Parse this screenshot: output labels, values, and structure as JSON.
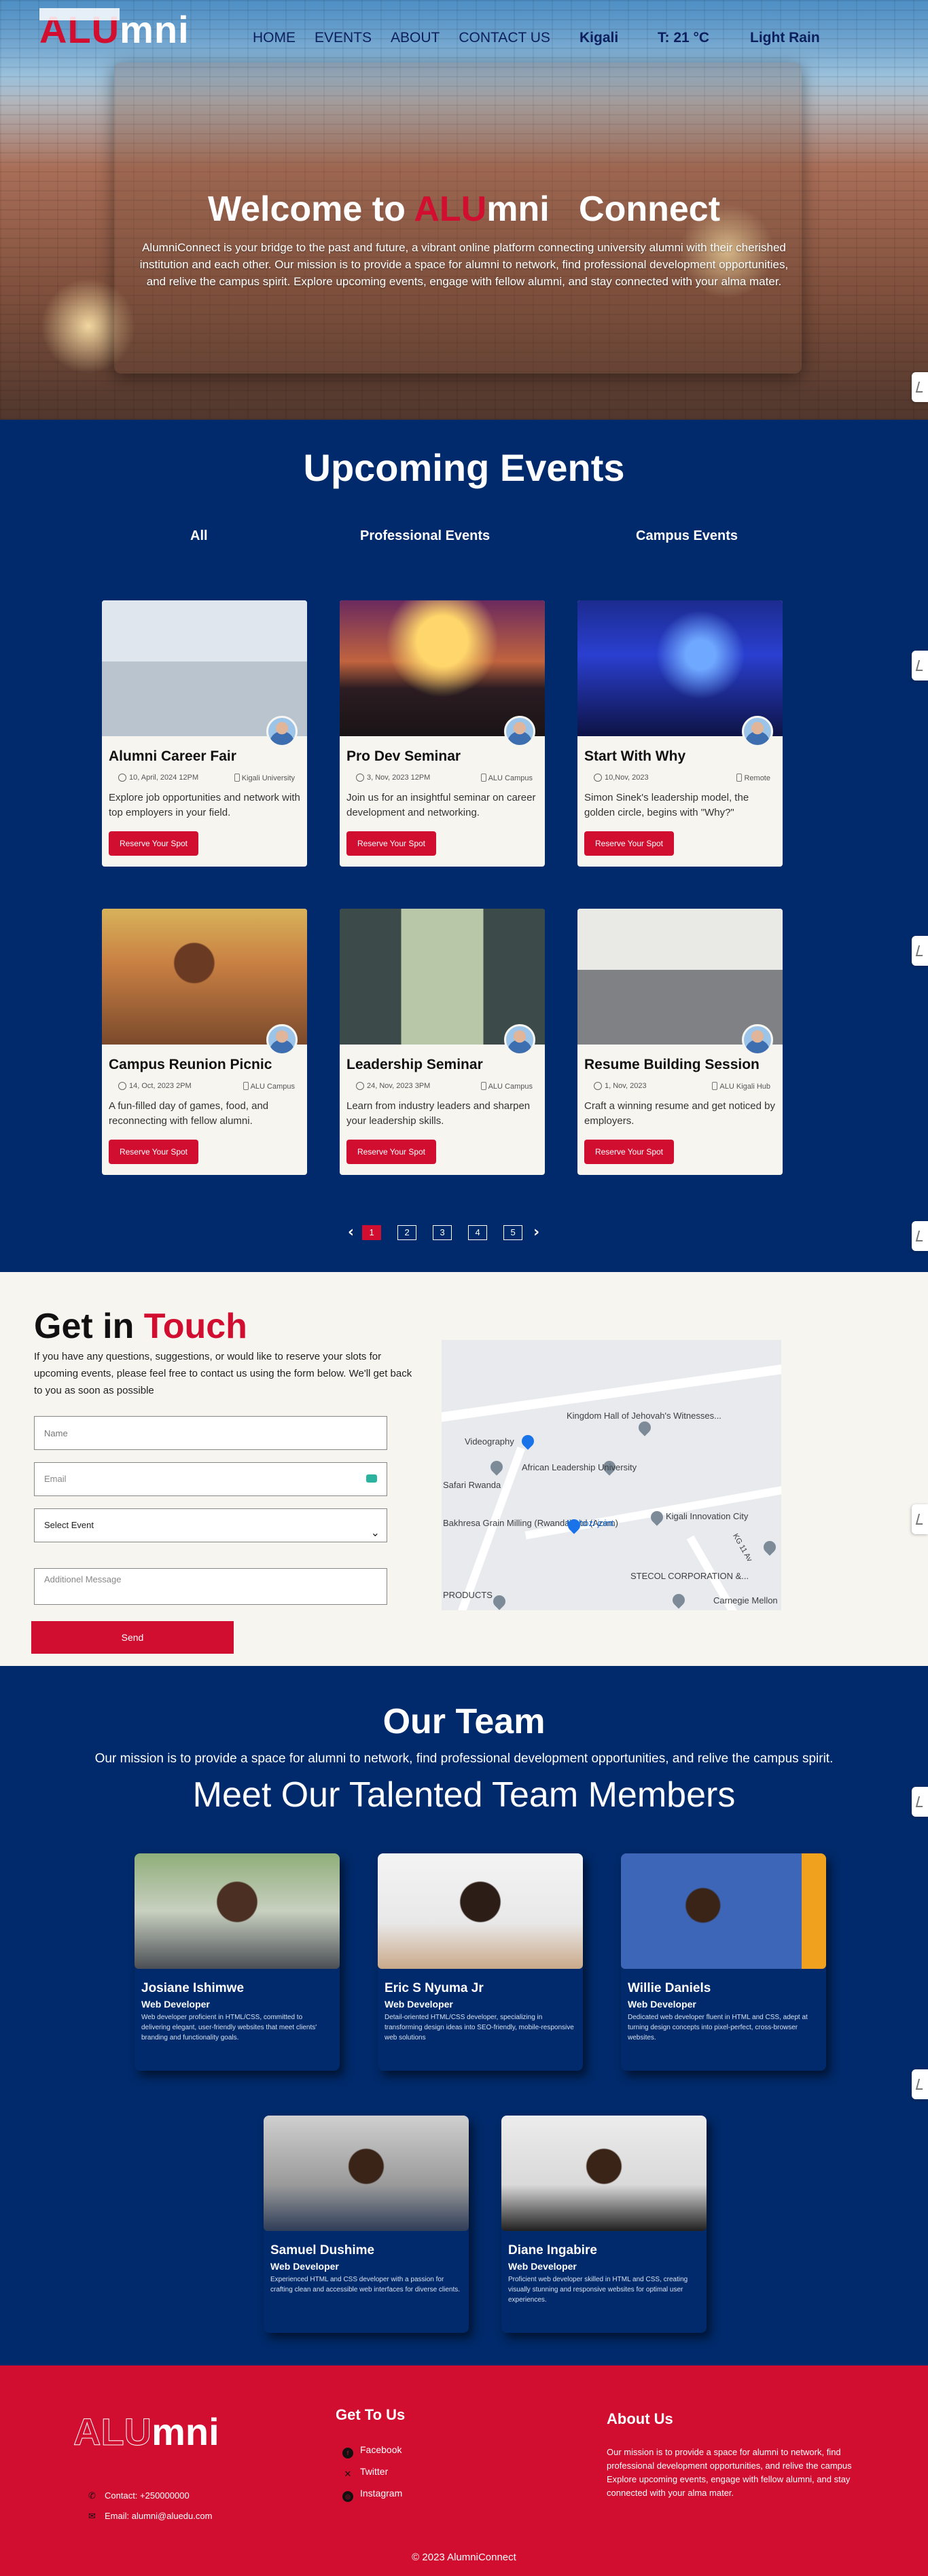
{
  "nav": {
    "logo_alu": "ALU",
    "logo_mni": "mni",
    "links": [
      "HOME",
      "EVENTS",
      "ABOUT",
      "CONTACT US"
    ],
    "city": "Kigali",
    "temp": "T: 21 °C",
    "condition": "Light Rain"
  },
  "hero": {
    "title_prefix": "Welcome to",
    "title_alu": "ALU",
    "title_mni": "mni",
    "title_suffix": "Connect",
    "text": "AlumniConnect is your bridge to the past and future, a vibrant online platform connecting university alumni with their cherished institution and each other. Our mission is to provide a space for alumni to network, find professional development opportunities, and relive the campus spirit. Explore upcoming events, engage with fellow alumni, and stay connected with your alma mater."
  },
  "events": {
    "heading": "Upcoming Events",
    "filters": [
      "All",
      "Professional Events",
      "Campus Events"
    ],
    "cards": [
      {
        "title": "Alumni Career Fair",
        "date": "10, April, 2024 12PM",
        "location": "Kigali University",
        "desc": "Explore job opportunities and network with top employers in your field.",
        "button": "Reserve Your Spot",
        "img": "career"
      },
      {
        "title": "Pro Dev Seminar",
        "date": "3, Nov, 2023 12PM",
        "location": "ALU Campus",
        "desc": "Join us for an insightful seminar on career development and networking.",
        "button": "Reserve Your Spot",
        "img": "seminar"
      },
      {
        "title": "Start With Why",
        "date": "10,Nov, 2023",
        "location": "Remote",
        "desc": "Simon Sinek's leadership model, the golden circle, begins with \"Why?\"",
        "button": "Reserve Your Spot",
        "img": "stage"
      },
      {
        "title": "Campus Reunion Picnic",
        "date": "14, Oct, 2023 2PM",
        "location": "ALU Campus",
        "desc": "A fun-filled day of games, food, and reconnecting with fellow alumni.",
        "button": "Reserve Your Spot",
        "img": "picnic"
      },
      {
        "title": "Leadership Seminar",
        "date": "24, Nov, 2023 3PM",
        "location": "ALU Campus",
        "desc": "Learn from industry leaders and sharpen your leadership skills.",
        "button": "Reserve Your Spot",
        "img": "leadership"
      },
      {
        "title": "Resume Building Session",
        "date": "1, Nov, 2023",
        "location": "ALU Kigali Hub",
        "desc": "Craft a winning resume and get noticed by employers.",
        "button": "Reserve Your Spot",
        "img": "classroom"
      }
    ],
    "pages": [
      "1",
      "2",
      "3",
      "4",
      "5"
    ],
    "prev": "‹",
    "next": "›"
  },
  "contact": {
    "heading_1": "Get in",
    "heading_2": "Touch",
    "lead": "If you have any questions, suggestions, or would like to reserve your slots for upcoming events, please feel free to contact us using the form below. We'll get back to you as soon as possible",
    "name_placeholder": "Name",
    "email_placeholder": "Email",
    "select_value": "Select Event",
    "message_placeholder": "Additionel Message",
    "send": "Send",
    "map_labels": [
      "Kingdom Hall of Jehovah's Witnesses...",
      "Videography",
      "African Leadership University",
      "Safari Rwanda",
      "Bakhresa Grain Milling (Rwanda) Ltd (Azam)",
      "Muhozi joint",
      "Kigali Innovation City",
      "STECOL CORPORATION &...",
      "PRODUCTS",
      "Carnegie Mellon",
      "KG 11 Av"
    ]
  },
  "team": {
    "heading": "Our Team",
    "mission": "Our mission is to provide a space for alumni to network, find professional development opportunities, and relive the campus spirit.",
    "subheading": "Meet Our Talented Team Members",
    "members": [
      {
        "name": "Josiane Ishimwe",
        "role": "Web Developer",
        "bio": "Web developer proficient in HTML/CSS, committed to delivering elegant, user-friendly websites that meet clients' branding and functionality goals."
      },
      {
        "name": "Eric S Nyuma Jr",
        "role": "Web Developer",
        "bio": "Detail-oriented HTML/CSS developer, specializing in transforming design ideas into SEO-friendly, mobile-responsive web solutions"
      },
      {
        "name": "Willie Daniels",
        "role": "Web Developer",
        "bio": "Dedicated web developer fluent in HTML and CSS, adept at turning design concepts into pixel-perfect, cross-browser websites."
      },
      {
        "name": "Samuel Dushime",
        "role": "Web Developer",
        "bio": "Experienced HTML and CSS developer with a passion for crafting clean and accessible web interfaces for diverse clients."
      },
      {
        "name": "Diane Ingabire",
        "role": "Web Developer",
        "bio": "Proficient web developer skilled in HTML and CSS, creating visually stunning and responsive websites for optimal user experiences."
      }
    ]
  },
  "footer": {
    "logo_alu": "ALU",
    "logo_mni": "mni",
    "contact_phone": "Contact: +250000000",
    "contact_email": "Email: alumni@aluedu.com",
    "get_to_us": "Get To Us",
    "socials": [
      "Facebook",
      "Twitter",
      "Instagram"
    ],
    "about_heading": "About Us",
    "about_text": "Our mission is to provide a space for alumni to network, find professional development opportunities, and relive the campus Explore upcoming events, engage with fellow alumni, and stay connected with your alma mater.",
    "copyright": "© 2023 AlumniConnect"
  },
  "colors": {
    "navy": "#002a6b",
    "red": "#d10d30",
    "cream": "#f7f5f0"
  }
}
